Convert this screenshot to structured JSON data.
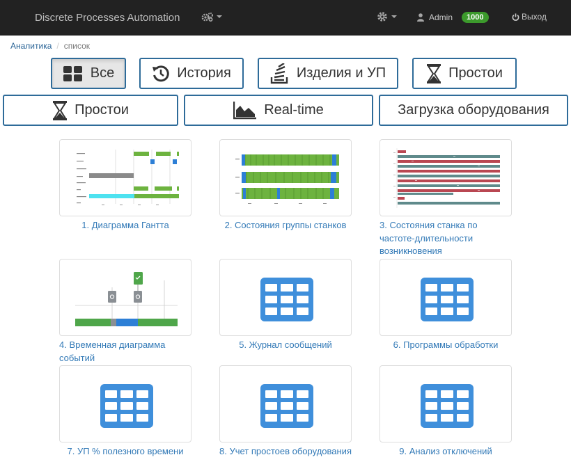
{
  "navbar": {
    "brand": "Discrete Processes Automation",
    "gears_icon": "cogs-icon",
    "settings_icon": "gear-icon",
    "user_icon": "user-icon",
    "user_name": "Admin",
    "user_badge": "1000",
    "logout_icon": "power-icon",
    "logout_label": "Выход",
    "badge_color": "#3c9a2c"
  },
  "breadcrumb": {
    "link": "Аналитика",
    "separator": "/",
    "current": "список"
  },
  "filters": [
    {
      "label": "Все",
      "icon": "grid-icon",
      "active": true
    },
    {
      "label": "История",
      "icon": "history-icon"
    },
    {
      "label": "Изделия и УП",
      "icon": "stack-icon"
    },
    {
      "label": "Простои",
      "icon": "hourglass-icon"
    },
    {
      "label": "Простои",
      "icon": "hourglass-icon"
    },
    {
      "label": "Real-time",
      "icon": "area-chart-icon"
    },
    {
      "label": "Загрузка оборудования"
    }
  ],
  "reports": [
    {
      "title": "1. Диаграмма Гантта",
      "thumb": "gantt-thumbnail"
    },
    {
      "title": "2. Состояния группы станков",
      "thumb": "machine-group-states-thumbnail"
    },
    {
      "title": "3. Состояния станка по частоте-длительности возникновения",
      "thumb": "machine-states-frequency-thumbnail"
    },
    {
      "title": "4. Временная диаграмма событий",
      "thumb": "event-timeline-thumbnail"
    },
    {
      "title": "5. Журнал сообщений",
      "thumb": "table-icon"
    },
    {
      "title": "6. Программы обработки",
      "thumb": "table-icon"
    },
    {
      "title": "7. УП % полезного времени",
      "thumb": "table-icon"
    },
    {
      "title": "8. Учет простоев оборудования",
      "thumb": "table-icon"
    },
    {
      "title": "9. Анализ отключений",
      "thumb": "table-icon"
    }
  ],
  "colors": {
    "accent_blue": "#337ab7",
    "button_border": "#2e6b99",
    "table_icon": "#3f8fdb",
    "state_green": "#6db33f",
    "state_blue": "#2d7fd6",
    "state_red": "#c0392b",
    "state_gray": "#5f8a8b"
  }
}
